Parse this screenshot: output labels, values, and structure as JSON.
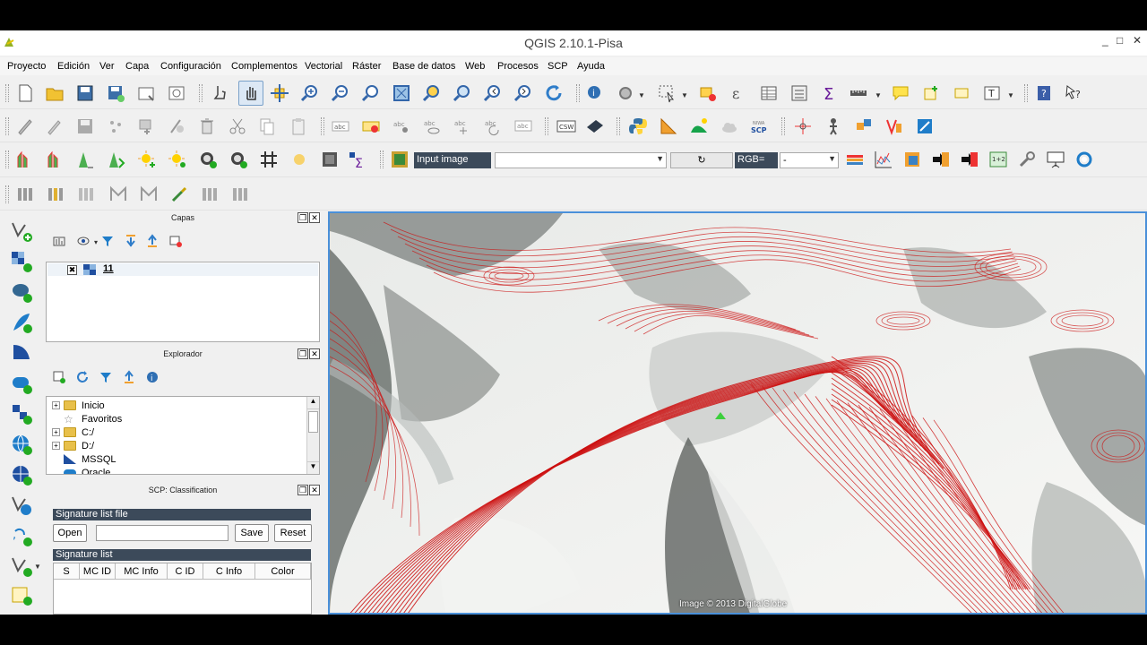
{
  "window": {
    "title": "QGIS 2.10.1-Pisa",
    "controls": [
      "_",
      "□",
      "✕"
    ]
  },
  "menu": [
    "Proyecto",
    "Edición",
    "Ver",
    "Capa",
    "Configuración",
    "Complementos",
    "Vectorial",
    "Ráster",
    "Base de datos",
    "Web",
    "Procesos",
    "SCP",
    "Ayuda"
  ],
  "toolbar3": {
    "input_image_label": "Input image",
    "input_image_value": "",
    "refresh_glyph": "↻",
    "rgb_label": "RGB=",
    "rgb_value": "-"
  },
  "panels": {
    "layers": {
      "title": "Capas",
      "items": [
        {
          "name": "11",
          "checked": true
        }
      ]
    },
    "browser": {
      "title": "Explorador",
      "items": [
        {
          "label": "Inicio",
          "expandable": true
        },
        {
          "label": "Favoritos",
          "expandable": false
        },
        {
          "label": "C:/",
          "expandable": true
        },
        {
          "label": "D:/",
          "expandable": true
        },
        {
          "label": "MSSQL",
          "expandable": false
        },
        {
          "label": "Oracle",
          "expandable": false
        }
      ]
    },
    "scp": {
      "title": "SCP: Classification",
      "signature_file_header": "Signature list file",
      "open_label": "Open",
      "file_path": "",
      "save_label": "Save",
      "reset_label": "Reset",
      "signature_list_header": "Signature list",
      "columns": [
        "S",
        "MC ID",
        "MC Info",
        "C ID",
        "C Info",
        "Color"
      ]
    }
  },
  "map": {
    "credit": "Image © 2013 DigitalGlobe",
    "contour_color": "#cc1111",
    "snow_color": "#f4f4f2",
    "rock_color": "#5a5f5c"
  },
  "colors": {
    "accent": "#4a90d9",
    "header_dark": "#3c4a5a"
  }
}
